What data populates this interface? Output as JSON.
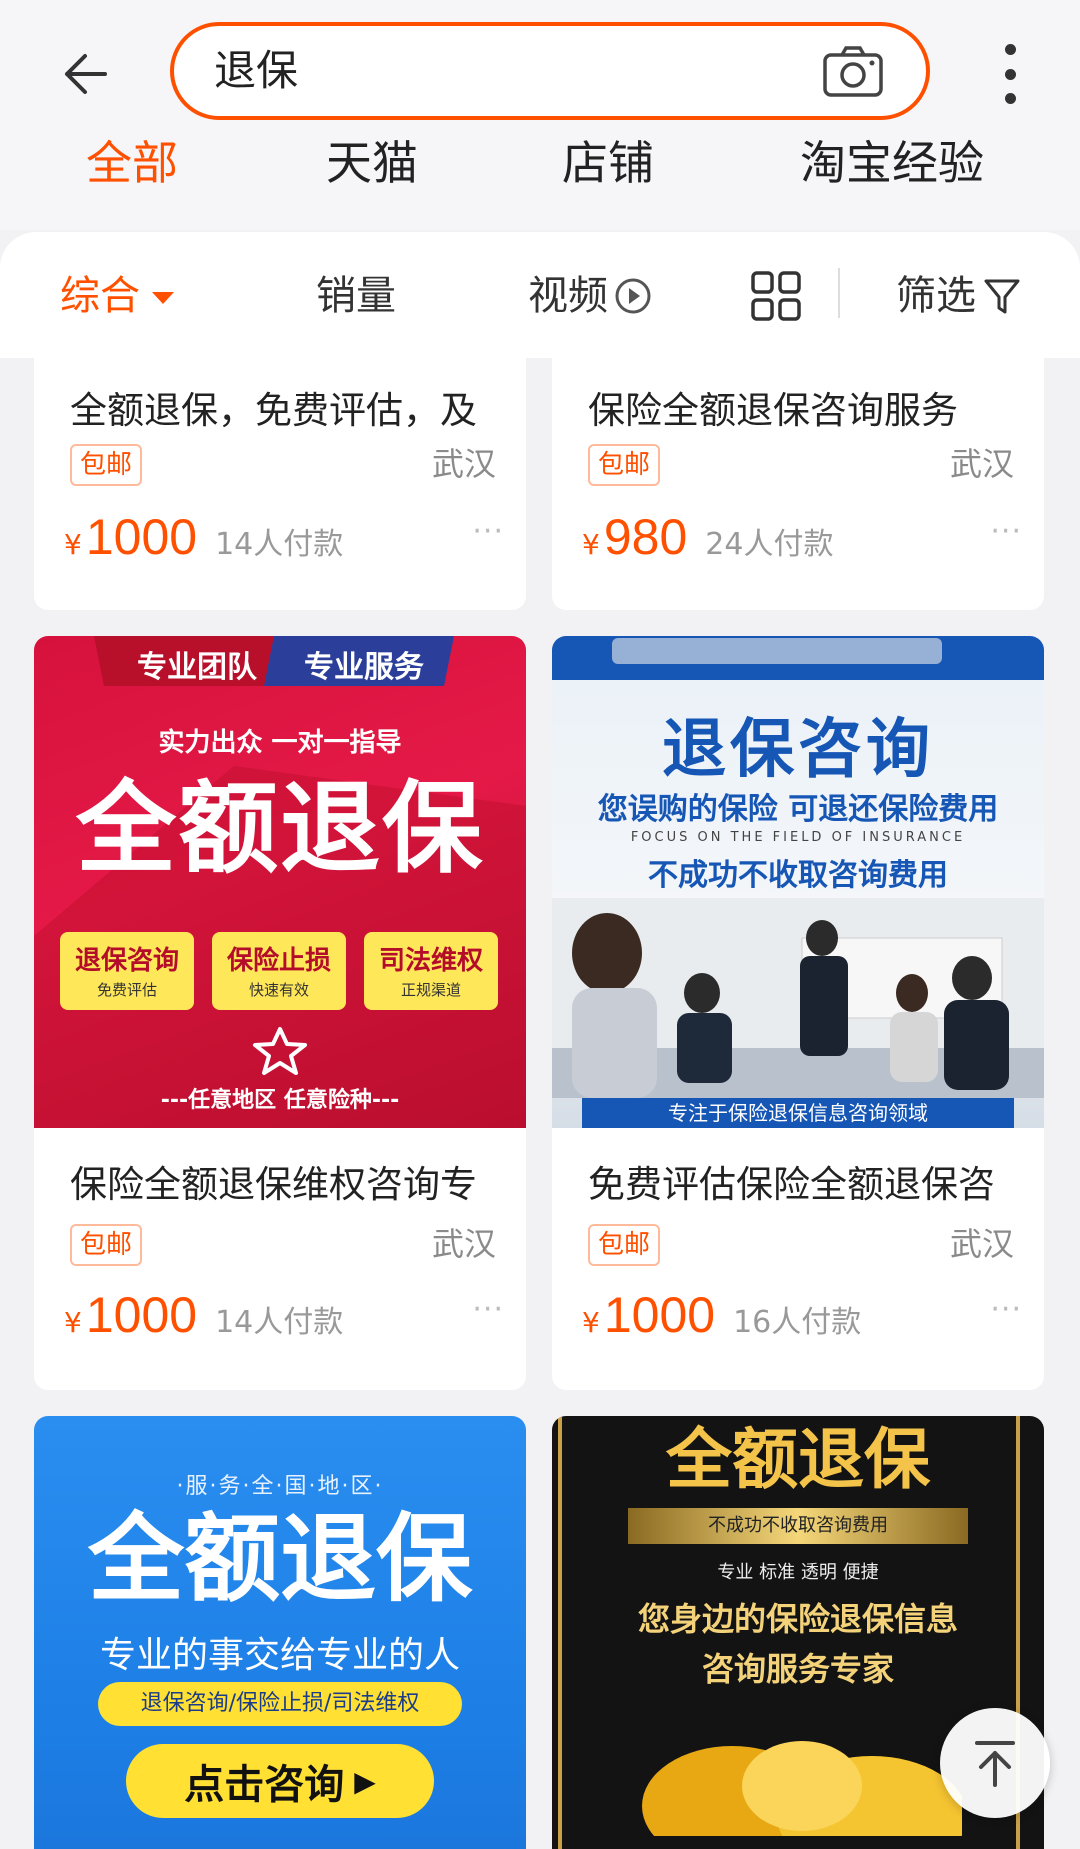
{
  "search": {
    "query": "退保"
  },
  "scope_tabs": [
    "全部",
    "天猫",
    "店铺",
    "淘宝经验"
  ],
  "sort": {
    "comprehensive": "综合",
    "sales": "销量",
    "video": "视频",
    "filter": "筛选"
  },
  "products": [
    {
      "title": "全额退保，免费评估，及",
      "badge": "包邮",
      "location": "武汉",
      "currency": "¥",
      "price": "1000",
      "sales": "14人付款"
    },
    {
      "title": "保险全额退保咨询服务",
      "badge": "包邮",
      "location": "武汉",
      "currency": "¥",
      "price": "980",
      "sales": "24人付款"
    },
    {
      "title": "保险全额退保维权咨询专",
      "badge": "包邮",
      "location": "武汉",
      "currency": "¥",
      "price": "1000",
      "sales": "14人付款"
    },
    {
      "title": "免费评估保险全额退保咨",
      "badge": "包邮",
      "location": "武汉",
      "currency": "¥",
      "price": "1000",
      "sales": "16人付款"
    }
  ],
  "banners": {
    "red": {
      "top_left": "专业团队",
      "top_right": "专业服务",
      "sub": "实力出众 一对一指导",
      "main": "全额退保",
      "boxes": [
        {
          "title": "退保咨询",
          "sub": "免费评估"
        },
        {
          "title": "保险止损",
          "sub": "快速有效"
        },
        {
          "title": "司法维权",
          "sub": "正规渠道"
        }
      ],
      "bottom": "---任意地区 任意险种---"
    },
    "blue": {
      "title": "退保咨询",
      "line1": "您误购的保险 可退还保险费用",
      "en": "FOCUS ON THE FIELD OF INSURANCE",
      "line2": "不成功不收取咨询费用",
      "footer": "专注于保险退保信息咨询领域"
    },
    "sky": {
      "top": "·服·务·全·国·地·区·",
      "main": "全额退保",
      "sub": "专业的事交给专业的人",
      "pill": "退保咨询/保险止损/司法维权",
      "cta": "点击咨询"
    },
    "dark": {
      "main": "全额退保",
      "ribbon": "不成功不收取咨询费用",
      "tags": "专业 标准 透明 便捷",
      "line1": "您身边的保险退保信息",
      "line2": "咨询服务专家"
    }
  },
  "colors": {
    "accent": "#ff5000",
    "background": "#f2f2f4"
  }
}
